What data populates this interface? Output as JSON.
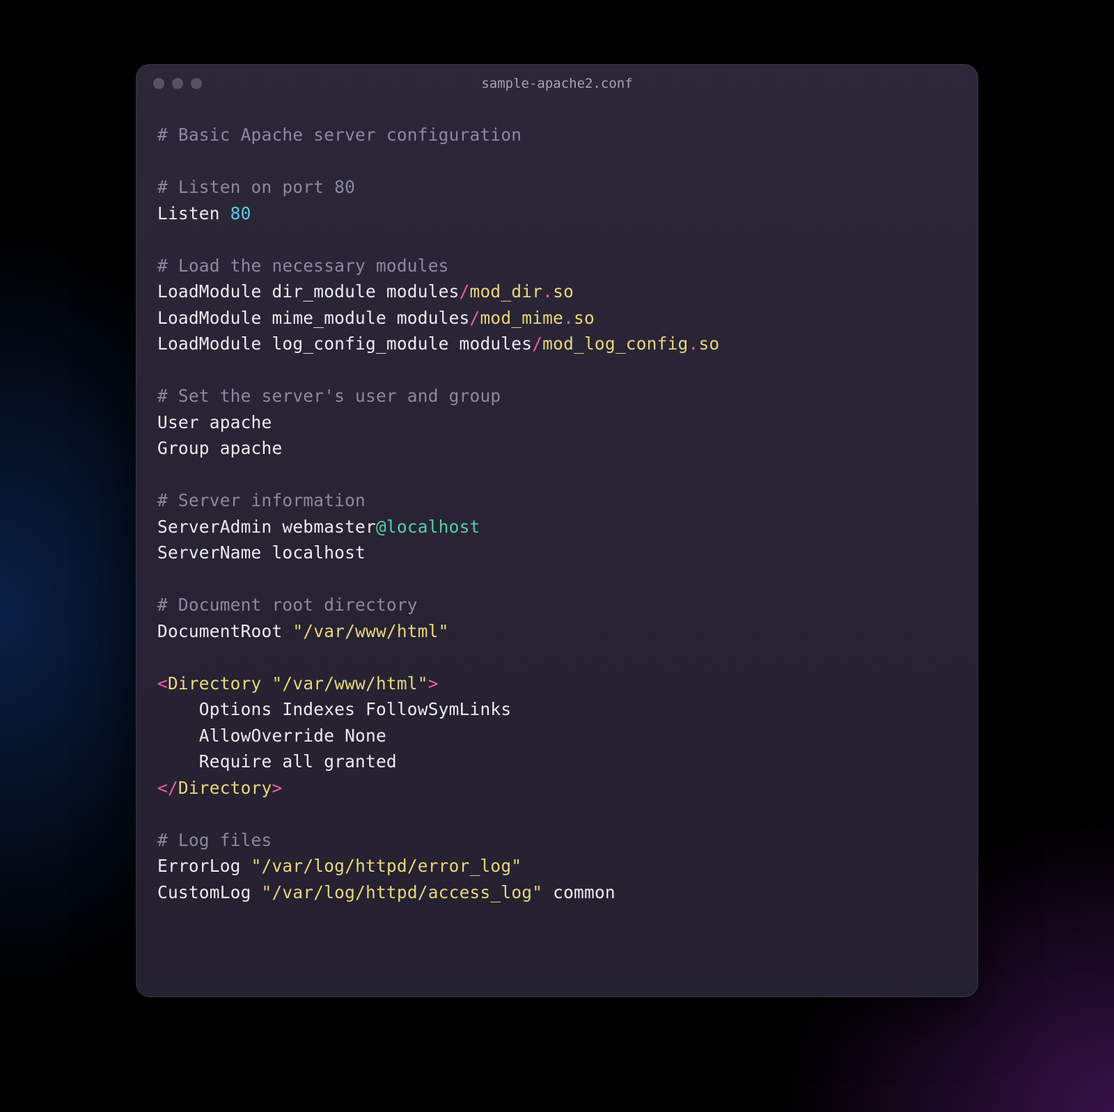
{
  "window": {
    "title": "sample-apache2.conf"
  },
  "tokens": [
    [
      [
        "c",
        "# Basic Apache server configuration"
      ]
    ],
    [],
    [
      [
        "c",
        "# Listen on port 80"
      ]
    ],
    [
      [
        "w",
        "Listen "
      ],
      [
        "n",
        "80"
      ]
    ],
    [],
    [
      [
        "c",
        "# Load the necessary modules"
      ]
    ],
    [
      [
        "w",
        "LoadModule dir_module modules"
      ],
      [
        "p",
        "/"
      ],
      [
        "s",
        "mod_dir"
      ],
      [
        "p",
        "."
      ],
      [
        "s",
        "so"
      ]
    ],
    [
      [
        "w",
        "LoadModule mime_module modules"
      ],
      [
        "p",
        "/"
      ],
      [
        "s",
        "mod_mime"
      ],
      [
        "p",
        "."
      ],
      [
        "s",
        "so"
      ]
    ],
    [
      [
        "w",
        "LoadModule log_config_module modules"
      ],
      [
        "p",
        "/"
      ],
      [
        "s",
        "mod_log_config"
      ],
      [
        "p",
        "."
      ],
      [
        "s",
        "so"
      ]
    ],
    [],
    [
      [
        "c",
        "# Set the server's user and group"
      ]
    ],
    [
      [
        "w",
        "User apache"
      ]
    ],
    [
      [
        "w",
        "Group apache"
      ]
    ],
    [],
    [
      [
        "c",
        "# Server information"
      ]
    ],
    [
      [
        "w",
        "ServerAdmin webmaster"
      ],
      [
        "at",
        "@localhost"
      ]
    ],
    [
      [
        "w",
        "ServerName localhost"
      ]
    ],
    [],
    [
      [
        "c",
        "# Document root directory"
      ]
    ],
    [
      [
        "w",
        "DocumentRoot "
      ],
      [
        "s",
        "\"/var/www/html\""
      ]
    ],
    [],
    [
      [
        "p",
        "<"
      ],
      [
        "s",
        "Directory "
      ],
      [
        "s",
        "\"/var/www/html\""
      ],
      [
        "p",
        ">"
      ]
    ],
    [
      [
        "w",
        "    Options Indexes FollowSymLinks"
      ]
    ],
    [
      [
        "w",
        "    AllowOverride None"
      ]
    ],
    [
      [
        "w",
        "    Require all granted"
      ]
    ],
    [
      [
        "p",
        "</"
      ],
      [
        "s",
        "Directory"
      ],
      [
        "p",
        ">"
      ]
    ],
    [],
    [
      [
        "c",
        "# Log files"
      ]
    ],
    [
      [
        "w",
        "ErrorLog "
      ],
      [
        "s",
        "\"/var/log/httpd/error_log\""
      ]
    ],
    [
      [
        "w",
        "CustomLog "
      ],
      [
        "s",
        "\"/var/log/httpd/access_log\""
      ],
      [
        "w",
        " common"
      ]
    ]
  ]
}
